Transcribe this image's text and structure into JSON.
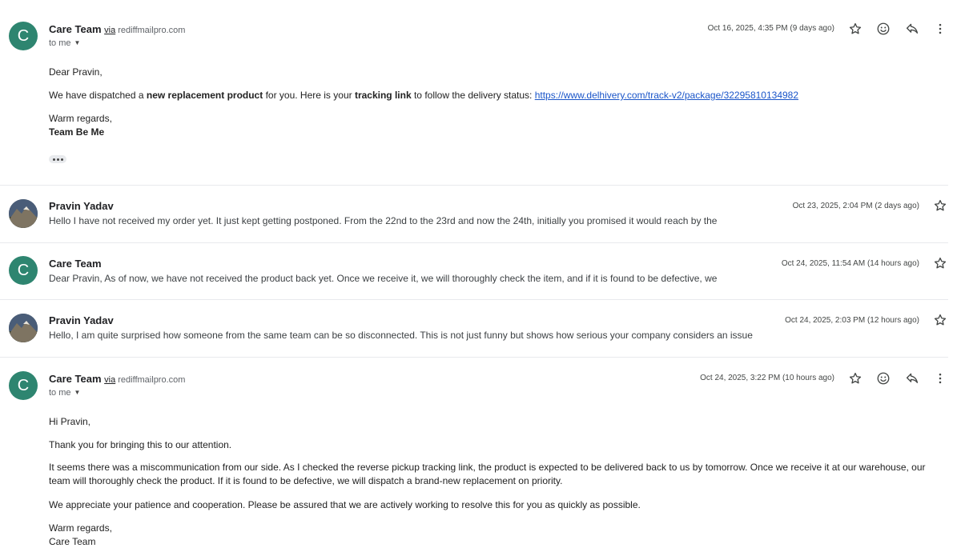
{
  "messages": [
    {
      "sender": "Care Team",
      "via_label": "via",
      "via_domain": "rediffmailpro.com",
      "to": "to me",
      "date": "Oct 16, 2025, 4:35 PM (9 days ago)",
      "greeting": "Dear Pravin,",
      "body_parts": {
        "p1": "We have dispatched a ",
        "b1": "new replacement product",
        "p2": " for you. Here is your ",
        "b2": "tracking link",
        "p3": " to follow the delivery status: ",
        "link": "https://www.delhivery.com/track-v2/package/32295810134982"
      },
      "closing": "Warm regards,",
      "signature": "Team Be Me"
    },
    {
      "sender": "Pravin Yadav",
      "date": "Oct 23, 2025, 2:04 PM (2 days ago)",
      "snippet": "Hello I have not received my order yet. It just kept getting postponed. From the 22nd to the 23rd and now the 24th, initially you promised it would reach by the"
    },
    {
      "sender": "Care Team",
      "date": "Oct 24, 2025, 11:54 AM (14 hours ago)",
      "snippet": "Dear Pravin, As of now, we have not received the product back yet. Once we receive it, we will thoroughly check the item, and if it is found to be defective, we"
    },
    {
      "sender": "Pravin Yadav",
      "date": "Oct 24, 2025, 2:03 PM (12 hours ago)",
      "snippet": "Hello, I am quite surprised how someone from the same team can be so disconnected. This is not just funny but shows how serious your company considers an issue"
    },
    {
      "sender": "Care Team",
      "via_label": "via",
      "via_domain": "rediffmailpro.com",
      "to": "to me",
      "date": "Oct 24, 2025, 3:22 PM (10 hours ago)",
      "greeting": "Hi Pravin,",
      "para1": "Thank you for bringing this to our attention.",
      "para2": "It seems there was a miscommunication from our side. As I checked the reverse pickup tracking link, the product is expected to be delivered back to us by tomorrow. Once we receive it at our warehouse, our team will thoroughly check the product. If it is found to be defective, we will dispatch a brand-new replacement on priority.",
      "para3": "We appreciate your patience and cooperation. Please be assured that we are actively working to resolve this for you as quickly as possible.",
      "closing": "Warm regards,",
      "signature": "Care Team"
    }
  ],
  "avatar_letter": "C",
  "icons": [
    "star-icon",
    "emoji-icon",
    "reply-icon",
    "more-vert-icon",
    "caret-down-icon",
    "ellipsis-icon"
  ],
  "colors": {
    "avatar_bg": "#2e8570",
    "link": "#1a55c9"
  }
}
